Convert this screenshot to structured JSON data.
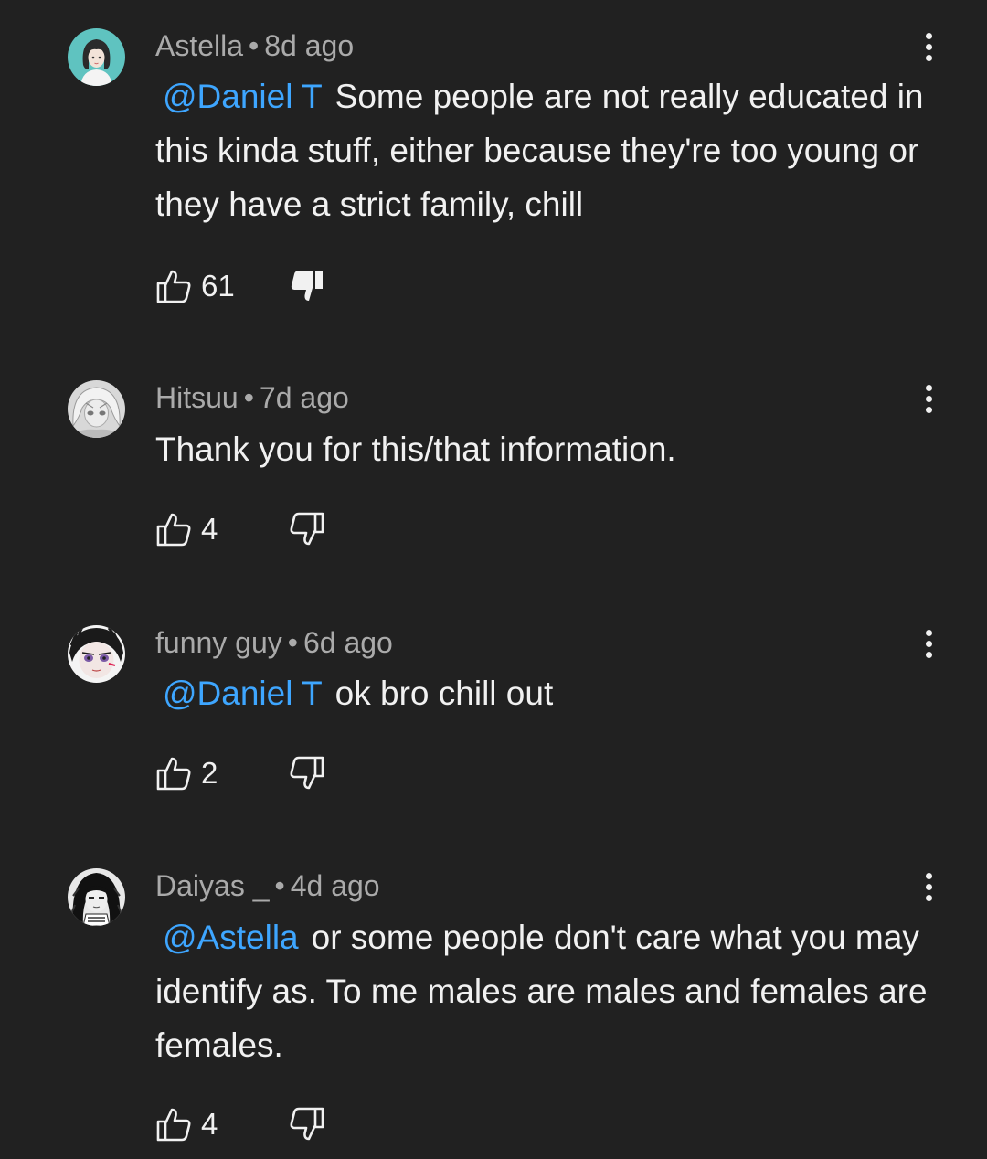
{
  "comments": [
    {
      "author": "Astella",
      "separator": "•",
      "time": "8d ago",
      "mention": "@Daniel T",
      "text": "Some people are not really educated in this kinda stuff, either because they're too young or they have a strict family, chill",
      "likes": "61",
      "disliked": true,
      "avatar_icon": "avatar-woman-teal-icon"
    },
    {
      "author": "Hitsuu",
      "separator": "•",
      "time": "7d ago",
      "mention": "",
      "text": "Thank you for this/that information.",
      "likes": "4",
      "disliked": false,
      "avatar_icon": "avatar-grey-anime-icon"
    },
    {
      "author": "funny guy",
      "separator": "•",
      "time": "6d ago",
      "mention": "@Daniel T",
      "text": "ok bro chill out",
      "likes": "2",
      "disliked": false,
      "avatar_icon": "avatar-anime-face-icon"
    },
    {
      "author": "Daiyas _",
      "separator": "•",
      "time": "4d ago",
      "mention": "@Astella",
      "text": "or some people don't care what you may identify as. To me males are males and females are females.",
      "likes": "4",
      "disliked": false,
      "avatar_icon": "avatar-dark-anime-icon"
    }
  ],
  "colors": {
    "background": "#212121",
    "text": "#f1f1f1",
    "meta": "#aaaaaa",
    "mention": "#3ea6ff"
  }
}
